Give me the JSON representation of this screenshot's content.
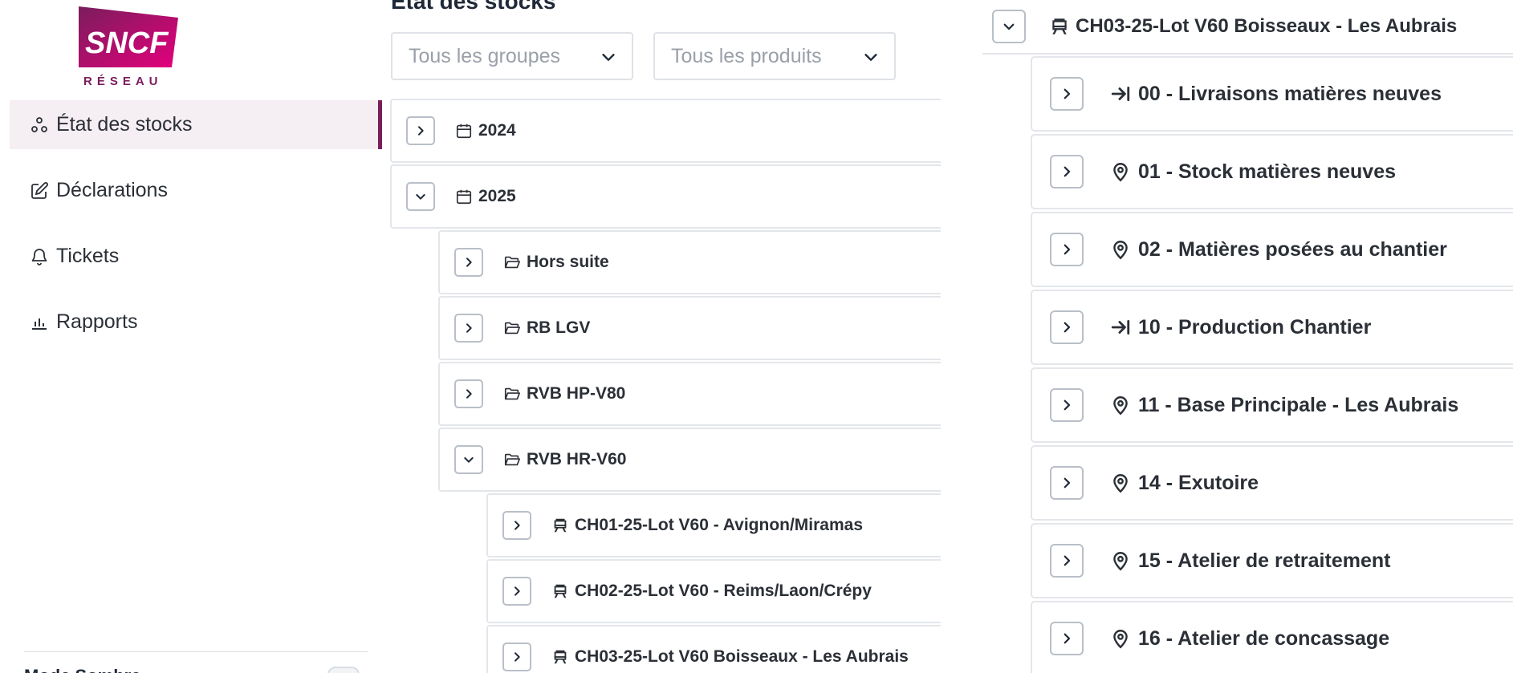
{
  "brand": {
    "logo_text": "SNCF",
    "logo_subtext": "RÉSEAU",
    "logo_colors": [
      "#e4007c",
      "#7a1d5c",
      "#b0007e"
    ]
  },
  "colors": {
    "accent": "#7a1d5c",
    "active_bg": "#f5eef3",
    "border": "#e3e6ea",
    "text": "#2b2f36",
    "placeholder": "#9aa0a8"
  },
  "sidebar": {
    "items": [
      {
        "label": "État des stocks",
        "icon": "network-icon",
        "active": true
      },
      {
        "label": "Déclarations",
        "icon": "edit-icon",
        "active": false
      },
      {
        "label": "Tickets",
        "icon": "bell-icon",
        "active": false
      },
      {
        "label": "Rapports",
        "icon": "chart-icon",
        "active": false
      }
    ],
    "bottom_label": "Mode Sombre"
  },
  "main": {
    "title": "État des stocks",
    "filters": {
      "groups": {
        "value": "Tous les groupes",
        "icon": "chevron-down-icon"
      },
      "products": {
        "value": "Tous les produits",
        "icon": "chevron-down-icon"
      }
    },
    "tree": [
      {
        "label": "2024",
        "icon": "calendar-icon",
        "expanded": false,
        "level": 0
      },
      {
        "label": "2025",
        "icon": "calendar-icon",
        "expanded": true,
        "level": 0
      },
      {
        "label": "Hors suite",
        "icon": "folder-open-icon",
        "expanded": false,
        "level": 1
      },
      {
        "label": "RB LGV",
        "icon": "folder-open-icon",
        "expanded": false,
        "level": 1
      },
      {
        "label": "RVB HP-V80",
        "icon": "folder-open-icon",
        "expanded": false,
        "level": 1
      },
      {
        "label": "RVB HR-V60",
        "icon": "folder-open-icon",
        "expanded": true,
        "level": 1
      },
      {
        "label": "CH01-25-Lot V60 - Avignon/Miramas",
        "icon": "train-icon",
        "expanded": false,
        "level": 2
      },
      {
        "label": "CH02-25-Lot V60 - Reims/Laon/Crépy",
        "icon": "train-icon",
        "expanded": false,
        "level": 2
      },
      {
        "label": "CH03-25-Lot V60 Boisseaux - Les Aubrais",
        "icon": "train-icon",
        "expanded": false,
        "level": 2
      }
    ]
  },
  "detail": {
    "header": {
      "label": "CH03-25-Lot V60 Boisseaux - Les Aubrais",
      "icon": "train-icon",
      "expanded": true
    },
    "items": [
      {
        "label": "00 - Livraisons matières neuves",
        "icon": "arrow-to-line-icon"
      },
      {
        "label": "01 - Stock matières neuves",
        "icon": "map-pin-icon"
      },
      {
        "label": "02 - Matières posées au chantier",
        "icon": "map-pin-icon"
      },
      {
        "label": "10 - Production Chantier",
        "icon": "arrow-to-line-icon"
      },
      {
        "label": "11 - Base Principale - Les Aubrais",
        "icon": "map-pin-icon"
      },
      {
        "label": "14 - Exutoire",
        "icon": "map-pin-icon"
      },
      {
        "label": "15 - Atelier de retraitement",
        "icon": "map-pin-icon"
      },
      {
        "label": "16 - Atelier de concassage",
        "icon": "map-pin-icon"
      }
    ]
  }
}
